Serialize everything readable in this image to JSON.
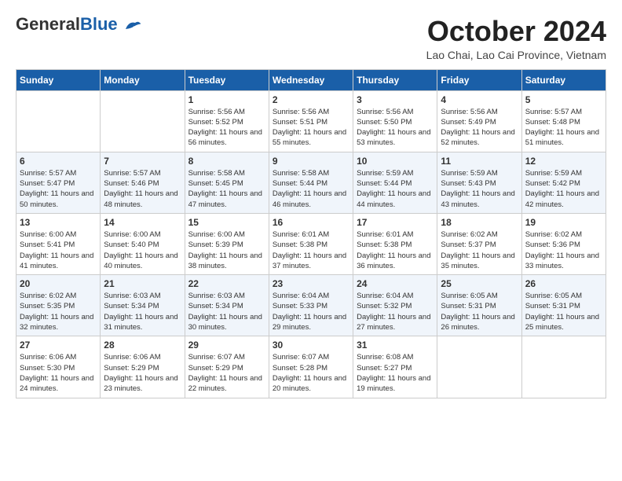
{
  "header": {
    "logo_general": "General",
    "logo_blue": "Blue",
    "month_title": "October 2024",
    "location": "Lao Chai, Lao Cai Province, Vietnam"
  },
  "weekdays": [
    "Sunday",
    "Monday",
    "Tuesday",
    "Wednesday",
    "Thursday",
    "Friday",
    "Saturday"
  ],
  "weeks": [
    [
      {
        "day": "",
        "info": ""
      },
      {
        "day": "",
        "info": ""
      },
      {
        "day": "1",
        "info": "Sunrise: 5:56 AM\nSunset: 5:52 PM\nDaylight: 11 hours and 56 minutes."
      },
      {
        "day": "2",
        "info": "Sunrise: 5:56 AM\nSunset: 5:51 PM\nDaylight: 11 hours and 55 minutes."
      },
      {
        "day": "3",
        "info": "Sunrise: 5:56 AM\nSunset: 5:50 PM\nDaylight: 11 hours and 53 minutes."
      },
      {
        "day": "4",
        "info": "Sunrise: 5:56 AM\nSunset: 5:49 PM\nDaylight: 11 hours and 52 minutes."
      },
      {
        "day": "5",
        "info": "Sunrise: 5:57 AM\nSunset: 5:48 PM\nDaylight: 11 hours and 51 minutes."
      }
    ],
    [
      {
        "day": "6",
        "info": "Sunrise: 5:57 AM\nSunset: 5:47 PM\nDaylight: 11 hours and 50 minutes."
      },
      {
        "day": "7",
        "info": "Sunrise: 5:57 AM\nSunset: 5:46 PM\nDaylight: 11 hours and 48 minutes."
      },
      {
        "day": "8",
        "info": "Sunrise: 5:58 AM\nSunset: 5:45 PM\nDaylight: 11 hours and 47 minutes."
      },
      {
        "day": "9",
        "info": "Sunrise: 5:58 AM\nSunset: 5:44 PM\nDaylight: 11 hours and 46 minutes."
      },
      {
        "day": "10",
        "info": "Sunrise: 5:59 AM\nSunset: 5:44 PM\nDaylight: 11 hours and 44 minutes."
      },
      {
        "day": "11",
        "info": "Sunrise: 5:59 AM\nSunset: 5:43 PM\nDaylight: 11 hours and 43 minutes."
      },
      {
        "day": "12",
        "info": "Sunrise: 5:59 AM\nSunset: 5:42 PM\nDaylight: 11 hours and 42 minutes."
      }
    ],
    [
      {
        "day": "13",
        "info": "Sunrise: 6:00 AM\nSunset: 5:41 PM\nDaylight: 11 hours and 41 minutes."
      },
      {
        "day": "14",
        "info": "Sunrise: 6:00 AM\nSunset: 5:40 PM\nDaylight: 11 hours and 40 minutes."
      },
      {
        "day": "15",
        "info": "Sunrise: 6:00 AM\nSunset: 5:39 PM\nDaylight: 11 hours and 38 minutes."
      },
      {
        "day": "16",
        "info": "Sunrise: 6:01 AM\nSunset: 5:38 PM\nDaylight: 11 hours and 37 minutes."
      },
      {
        "day": "17",
        "info": "Sunrise: 6:01 AM\nSunset: 5:38 PM\nDaylight: 11 hours and 36 minutes."
      },
      {
        "day": "18",
        "info": "Sunrise: 6:02 AM\nSunset: 5:37 PM\nDaylight: 11 hours and 35 minutes."
      },
      {
        "day": "19",
        "info": "Sunrise: 6:02 AM\nSunset: 5:36 PM\nDaylight: 11 hours and 33 minutes."
      }
    ],
    [
      {
        "day": "20",
        "info": "Sunrise: 6:02 AM\nSunset: 5:35 PM\nDaylight: 11 hours and 32 minutes."
      },
      {
        "day": "21",
        "info": "Sunrise: 6:03 AM\nSunset: 5:34 PM\nDaylight: 11 hours and 31 minutes."
      },
      {
        "day": "22",
        "info": "Sunrise: 6:03 AM\nSunset: 5:34 PM\nDaylight: 11 hours and 30 minutes."
      },
      {
        "day": "23",
        "info": "Sunrise: 6:04 AM\nSunset: 5:33 PM\nDaylight: 11 hours and 29 minutes."
      },
      {
        "day": "24",
        "info": "Sunrise: 6:04 AM\nSunset: 5:32 PM\nDaylight: 11 hours and 27 minutes."
      },
      {
        "day": "25",
        "info": "Sunrise: 6:05 AM\nSunset: 5:31 PM\nDaylight: 11 hours and 26 minutes."
      },
      {
        "day": "26",
        "info": "Sunrise: 6:05 AM\nSunset: 5:31 PM\nDaylight: 11 hours and 25 minutes."
      }
    ],
    [
      {
        "day": "27",
        "info": "Sunrise: 6:06 AM\nSunset: 5:30 PM\nDaylight: 11 hours and 24 minutes."
      },
      {
        "day": "28",
        "info": "Sunrise: 6:06 AM\nSunset: 5:29 PM\nDaylight: 11 hours and 23 minutes."
      },
      {
        "day": "29",
        "info": "Sunrise: 6:07 AM\nSunset: 5:29 PM\nDaylight: 11 hours and 22 minutes."
      },
      {
        "day": "30",
        "info": "Sunrise: 6:07 AM\nSunset: 5:28 PM\nDaylight: 11 hours and 20 minutes."
      },
      {
        "day": "31",
        "info": "Sunrise: 6:08 AM\nSunset: 5:27 PM\nDaylight: 11 hours and 19 minutes."
      },
      {
        "day": "",
        "info": ""
      },
      {
        "day": "",
        "info": ""
      }
    ]
  ]
}
